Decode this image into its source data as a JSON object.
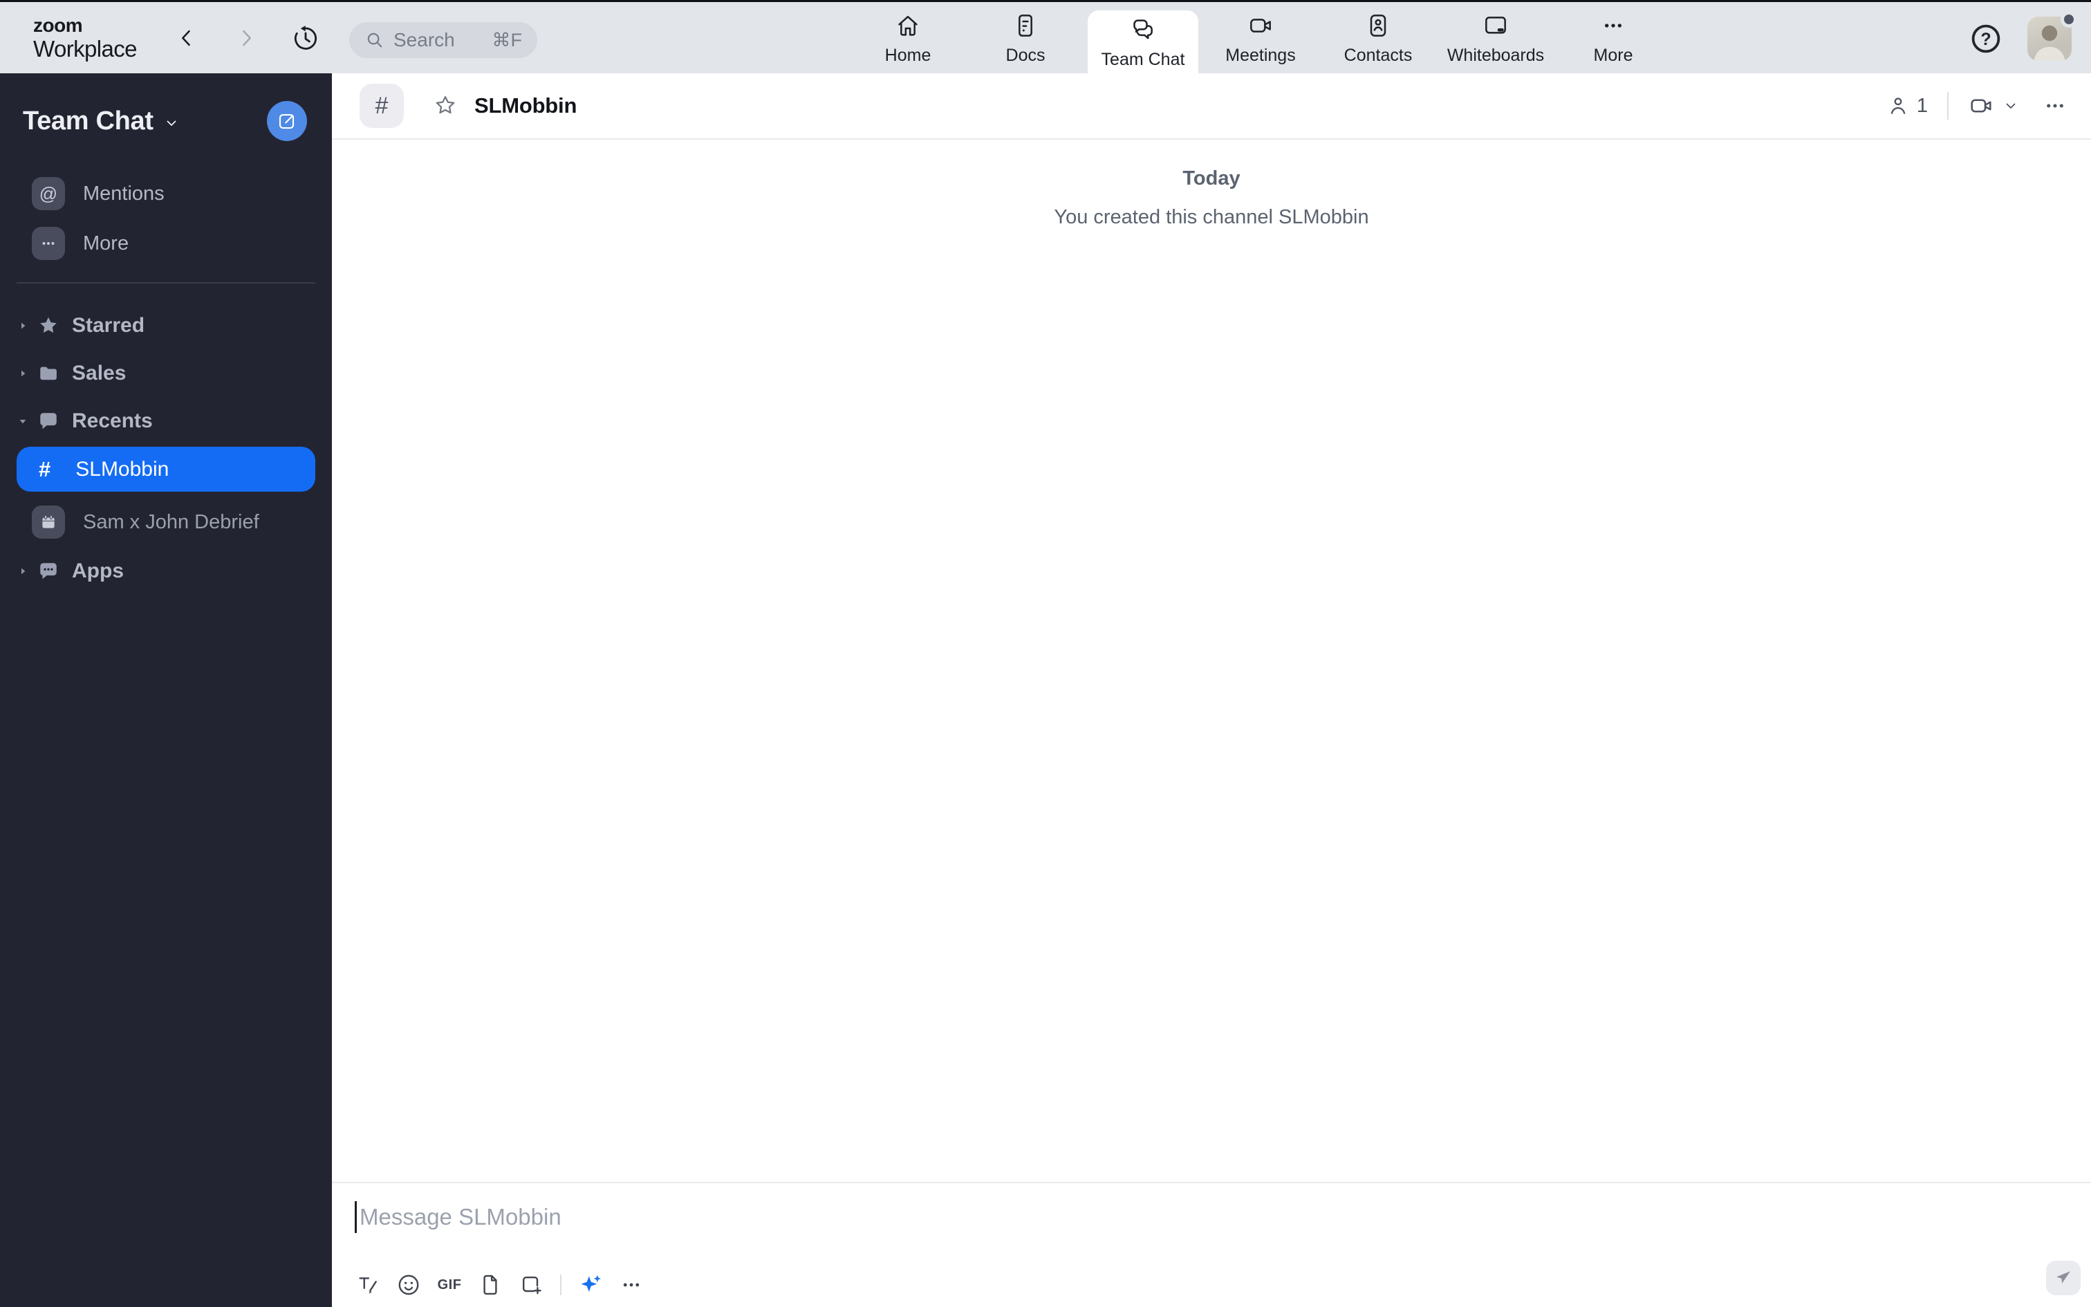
{
  "colors": {
    "topbar_bg": "#e2e5e9",
    "sidebar_bg": "#232431",
    "selected_channel_blue": "#146cf4",
    "compose_button_blue": "#4e8ae6",
    "ai_sparkle_blue": "#1672ec",
    "status_dot": "#515766"
  },
  "app": {
    "logo_top": "zoom",
    "logo_bottom": "Workplace"
  },
  "topbar": {
    "help_glyph": "?",
    "search": {
      "placeholder": "Search",
      "shortcut": "⌘F"
    },
    "tabs": [
      {
        "label": "Home",
        "active": false
      },
      {
        "label": "Docs",
        "active": false
      },
      {
        "label": "Team Chat",
        "active": true
      },
      {
        "label": "Meetings",
        "active": false
      },
      {
        "label": "Contacts",
        "active": false
      },
      {
        "label": "Whiteboards",
        "active": false
      },
      {
        "label": "More",
        "active": false
      }
    ]
  },
  "sidebar": {
    "title": "Team Chat",
    "shortcuts": [
      {
        "label": "Mentions",
        "glyph": "@"
      },
      {
        "label": "More"
      }
    ],
    "sections": [
      {
        "label": "Starred",
        "state": "collapsed"
      },
      {
        "label": "Sales",
        "state": "collapsed"
      },
      {
        "label": "Recents",
        "state": "expanded"
      },
      {
        "label": "Apps",
        "state": "collapsed"
      }
    ],
    "recents_items": [
      {
        "prefix": "#",
        "name": "SLMobbin",
        "selected": true
      },
      {
        "name": "Sam x John Debrief",
        "selected": false
      }
    ]
  },
  "main": {
    "header": {
      "channel_prefix": "#",
      "channel_name": "SLMobbin",
      "member_count": "1"
    },
    "timeline": {
      "date_label": "Today",
      "system_message": "You created this channel SLMobbin"
    },
    "composer": {
      "placeholder": "Message SLMobbin",
      "gif_label": "GIF"
    }
  }
}
